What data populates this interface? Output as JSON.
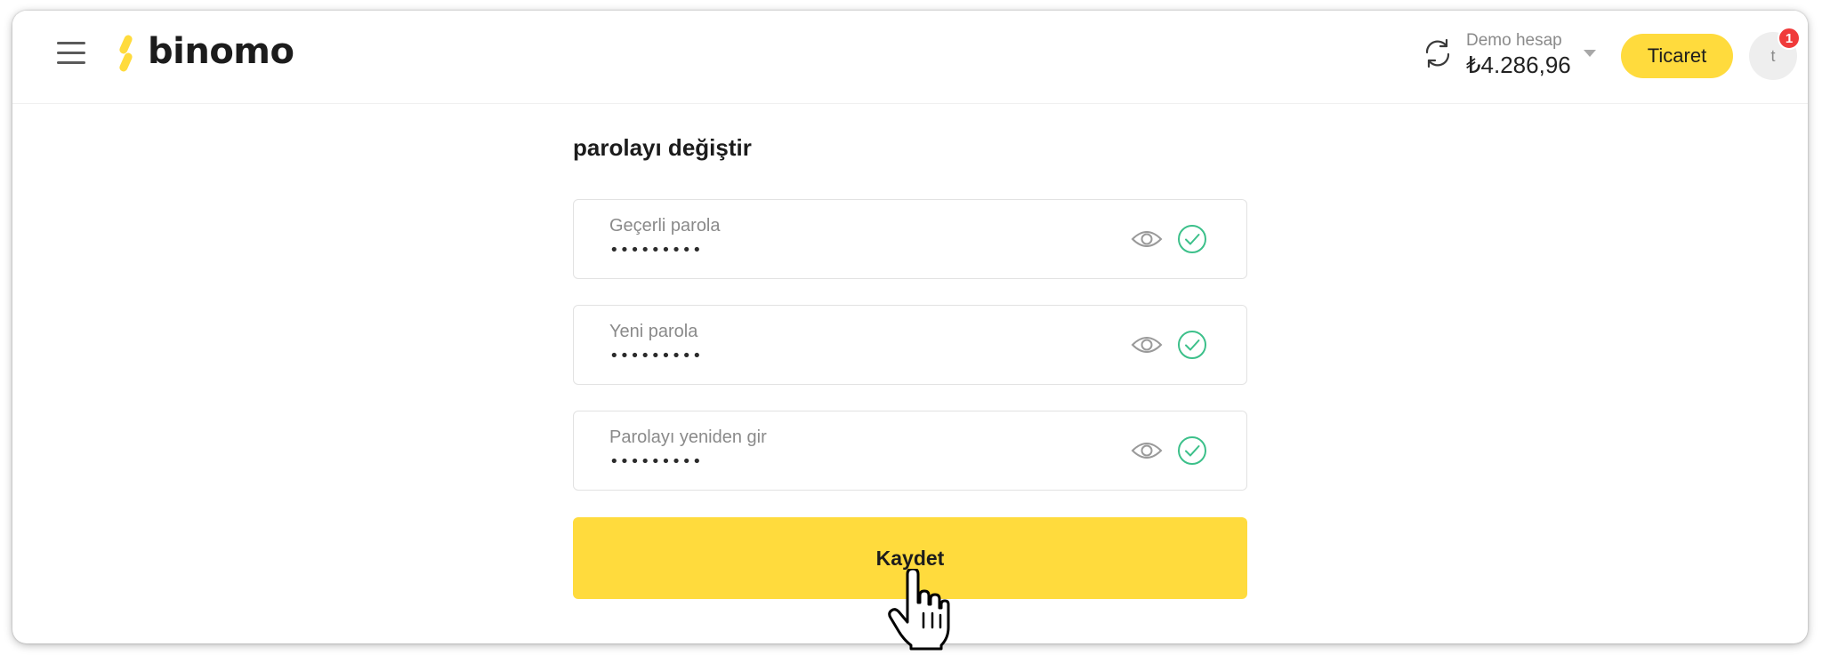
{
  "brand": {
    "name": "binomo",
    "accent_color": "#ffdb3d"
  },
  "header": {
    "menu_icon": "hamburger-menu-icon",
    "sync_icon": "sync-icon",
    "account": {
      "label": "Demo hesap",
      "balance": "₺4.286,96"
    },
    "trade_button_label": "Ticaret",
    "avatar_initial": "t",
    "notification_count": "1",
    "badge_color": "#f03a3a"
  },
  "page": {
    "title": "parolayı değiştir"
  },
  "form": {
    "fields": [
      {
        "label": "Geçerli parola",
        "value": "•••••••••"
      },
      {
        "label": "Yeni parola",
        "value": "•••••••••"
      },
      {
        "label": "Parolayı yeniden gir",
        "value": "•••••••••"
      }
    ],
    "valid_color": "#3cc08a",
    "save_label": "Kaydet"
  }
}
